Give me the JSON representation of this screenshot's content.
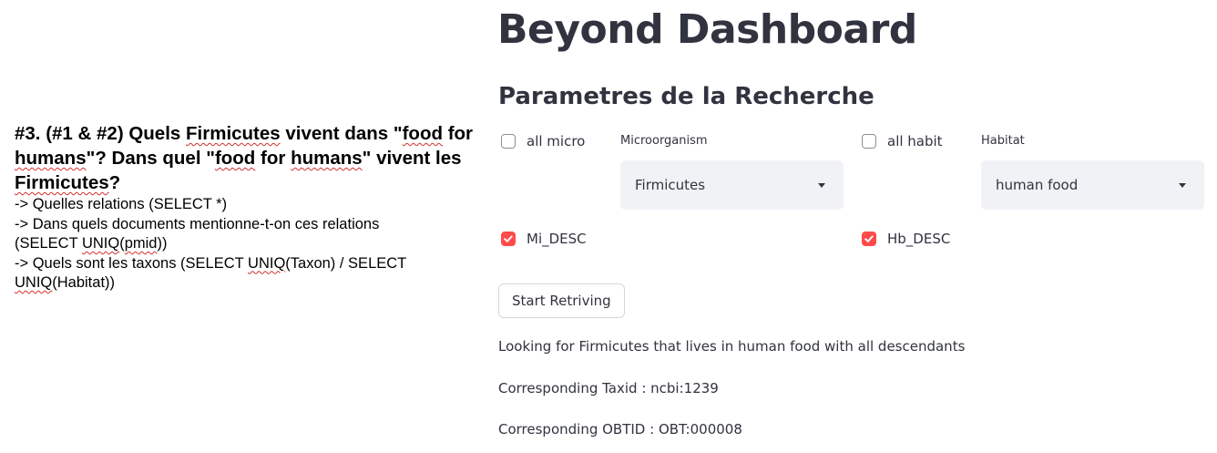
{
  "note": {
    "heading_segments": [
      {
        "text": "#3. (#1 & #2) Quels ",
        "q": false
      },
      {
        "text": "Firmicutes",
        "q": true
      },
      {
        "text": " vivent dans \"",
        "q": false
      },
      {
        "text": "food",
        "q": true
      },
      {
        "text": " for ",
        "q": false
      },
      {
        "text": "humans",
        "q": true
      },
      {
        "text": "\"? Dans quel \"",
        "q": false
      },
      {
        "text": "food",
        "q": true
      },
      {
        "text": " for ",
        "q": false
      },
      {
        "text": "humans",
        "q": true
      },
      {
        "text": "\" vivent les ",
        "q": false
      },
      {
        "text": "Firmicutes",
        "q": true
      },
      {
        "text": "?",
        "q": false
      }
    ],
    "lines": [
      [
        {
          "text": "-> Quelles relations (SELECT *)",
          "q": false
        }
      ],
      [
        {
          "text": "-> Dans quels documents mentionne-t-on ces relations",
          "q": false
        }
      ],
      [
        {
          "text": "(SELECT ",
          "q": false
        },
        {
          "text": "UNIQ",
          "q": true
        },
        {
          "text": "(",
          "q": false
        },
        {
          "text": "pmid",
          "q": true
        },
        {
          "text": "))",
          "q": false
        }
      ],
      [
        {
          "text": "-> Quels sont les taxons (SELECT ",
          "q": false
        },
        {
          "text": "UNIQ",
          "q": true
        },
        {
          "text": "(Taxon) / SELECT",
          "q": false
        }
      ],
      [
        {
          "text": "UNIQ",
          "q": true
        },
        {
          "text": "(Habitat))",
          "q": false
        }
      ]
    ]
  },
  "dashboard": {
    "title": "Beyond Dashboard",
    "subheader": "Parametres de la Recherche",
    "all_micro_label": "all micro",
    "all_micro_checked": false,
    "microorganism_label": "Microorganism",
    "microorganism_value": "Firmicutes",
    "all_habit_label": "all habit",
    "all_habit_checked": false,
    "habitat_label": "Habitat",
    "habitat_value": "human food",
    "mi_desc_label": "Mi_DESC",
    "mi_desc_checked": true,
    "hb_desc_label": "Hb_DESC",
    "hb_desc_checked": true,
    "start_button": "Start Retriving",
    "looking_text": "Looking for Firmicutes that lives in human food with all descendants",
    "taxid_text": "Corresponding Taxid : ncbi:1239",
    "obtid_text": "Corresponding OBTID : OBT:000008"
  },
  "colors": {
    "accent": "#ff4b4b",
    "text": "#31333f",
    "select_bg": "#f0f2f6",
    "spellcheck": "#d32f2f"
  },
  "icons": {
    "checkbox_check": "check-icon",
    "select_caret": "chevron-down-icon"
  }
}
